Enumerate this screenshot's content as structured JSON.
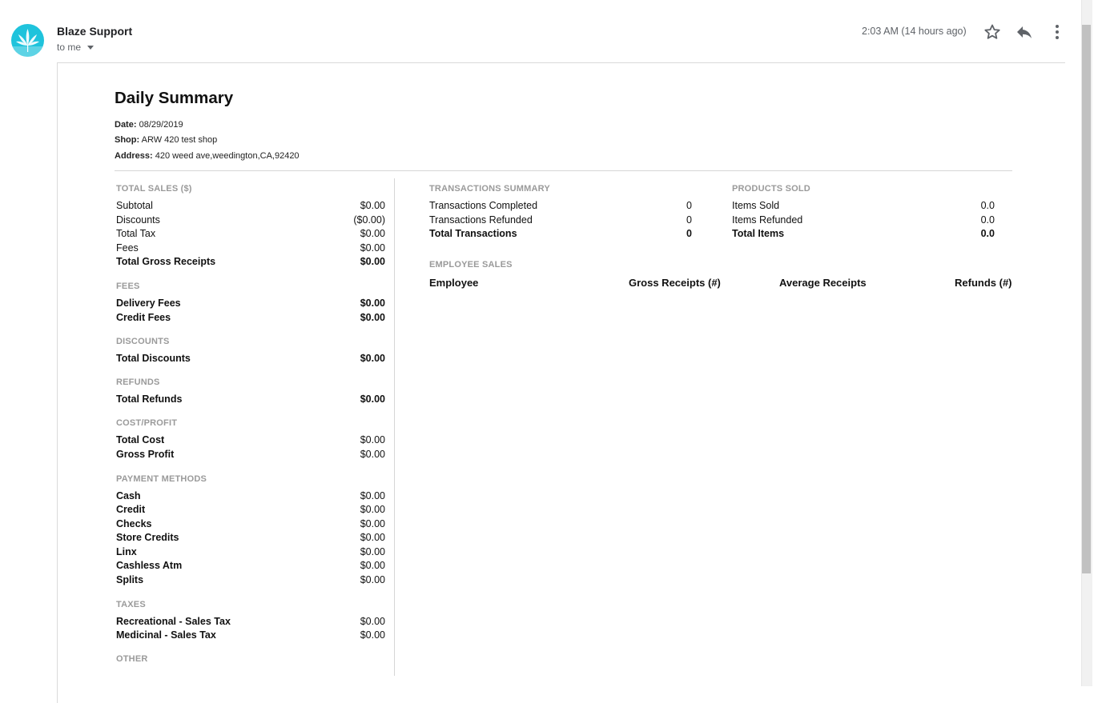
{
  "email": {
    "sender": "Blaze Support",
    "recipient": "to me",
    "time": "2:03 AM (14 hours ago)",
    "icons": {
      "avatar": "cannabis-leaf-icon",
      "star": "star-icon",
      "reply": "reply-icon",
      "more": "more-vert-icon"
    },
    "accent": "#1fc3dc"
  },
  "report": {
    "title": "Daily Summary",
    "date_label": "Date:",
    "date": "08/29/2019",
    "shop_label": "Shop:",
    "shop": "ARW 420 test shop",
    "address_label": "Address:",
    "address": "420 weed ave,weedington,CA,92420"
  },
  "left": {
    "total_sales": {
      "heading": "TOTAL SALES ($)",
      "rows": [
        {
          "label": "Subtotal",
          "value": "$0.00"
        },
        {
          "label": "Discounts",
          "value": "($0.00)"
        },
        {
          "label": "Total Tax",
          "value": "$0.00"
        },
        {
          "label": "Fees",
          "value": "$0.00"
        },
        {
          "label": "Total Gross Receipts",
          "value": "$0.00"
        }
      ]
    },
    "fees": {
      "heading": "FEES",
      "rows": [
        {
          "label": "Delivery Fees",
          "value": "$0.00"
        },
        {
          "label": "Credit Fees",
          "value": "$0.00"
        }
      ]
    },
    "discounts": {
      "heading": "DISCOUNTS",
      "rows": [
        {
          "label": "Total Discounts",
          "value": "$0.00"
        }
      ]
    },
    "refunds": {
      "heading": "REFUNDS",
      "rows": [
        {
          "label": "Total Refunds",
          "value": "$0.00"
        }
      ]
    },
    "cost_profit": {
      "heading": "COST/PROFIT",
      "rows": [
        {
          "label": "Total Cost",
          "value": "$0.00"
        },
        {
          "label": "Gross Profit",
          "value": "$0.00"
        }
      ]
    },
    "payment_methods": {
      "heading": "PAYMENT METHODS",
      "rows": [
        {
          "label": "Cash",
          "value": "$0.00"
        },
        {
          "label": "Credit",
          "value": "$0.00"
        },
        {
          "label": "Checks",
          "value": "$0.00"
        },
        {
          "label": "Store Credits",
          "value": "$0.00"
        },
        {
          "label": "Linx",
          "value": "$0.00"
        },
        {
          "label": "Cashless Atm",
          "value": "$0.00"
        },
        {
          "label": "Splits",
          "value": "$0.00"
        }
      ]
    },
    "taxes": {
      "heading": "TAXES",
      "rows": [
        {
          "label": "Recreational - Sales Tax",
          "value": "$0.00"
        },
        {
          "label": "Medicinal - Sales Tax",
          "value": "$0.00"
        }
      ]
    },
    "other": {
      "heading": "OTHER"
    }
  },
  "transactions": {
    "heading": "TRANSACTIONS SUMMARY",
    "rows": [
      {
        "label": "Transactions Completed",
        "value": "0"
      },
      {
        "label": "Transactions Refunded",
        "value": "0"
      },
      {
        "label": "Total Transactions",
        "value": "0"
      }
    ]
  },
  "products": {
    "heading": "PRODUCTS SOLD",
    "rows": [
      {
        "label": "Items Sold",
        "value": "0.0"
      },
      {
        "label": "Items Refunded",
        "value": "0.0"
      },
      {
        "label": "Total Items",
        "value": "0.0"
      }
    ]
  },
  "employee_sales": {
    "heading": "EMPLOYEE SALES",
    "columns": [
      "Employee",
      "Gross Receipts (#)",
      "Average Receipts",
      "Refunds (#)"
    ]
  }
}
